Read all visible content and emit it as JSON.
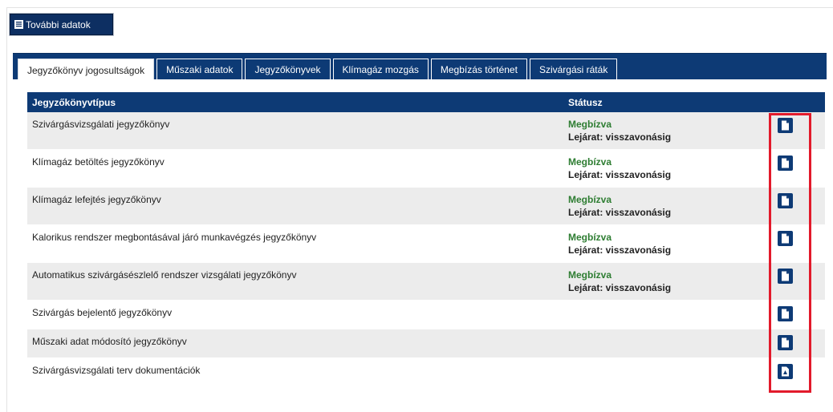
{
  "toolbar": {
    "more_data_label": "További adatok"
  },
  "tabs": [
    {
      "label": "Jegyzőkönyv jogosultságok",
      "active": true
    },
    {
      "label": "Műszaki adatok",
      "active": false
    },
    {
      "label": "Jegyzőkönyvek",
      "active": false
    },
    {
      "label": "Klímagáz mozgás",
      "active": false
    },
    {
      "label": "Megbízás történet",
      "active": false
    },
    {
      "label": "Szivárgási ráták",
      "active": false
    }
  ],
  "table": {
    "headers": {
      "type": "Jegyzőkönyvtípus",
      "status": "Státusz"
    },
    "rows": [
      {
        "type": "Szivárgásvizsgálati jegyzőkönyv",
        "status": "Megbízva",
        "expiry": "Lejárat: visszavonásig",
        "icon": "document-icon"
      },
      {
        "type": "Klímagáz betöltés jegyzőkönyv",
        "status": "Megbízva",
        "expiry": "Lejárat: visszavonásig",
        "icon": "document-icon"
      },
      {
        "type": "Klímagáz lefejtés jegyzőkönyv",
        "status": "Megbízva",
        "expiry": "Lejárat: visszavonásig",
        "icon": "document-icon"
      },
      {
        "type": "Kalorikus rendszer megbontásával járó munkavégzés jegyzőkönyv",
        "status": "Megbízva",
        "expiry": "Lejárat: visszavonásig",
        "icon": "document-icon"
      },
      {
        "type": "Automatikus szivárgásészlelő rendszer vizsgálati jegyzőkönyv",
        "status": "Megbízva",
        "expiry": "Lejárat: visszavonásig",
        "icon": "document-icon"
      },
      {
        "type": "Szivárgás bejelentő jegyzőkönyv",
        "status": "",
        "expiry": "",
        "icon": "document-icon"
      },
      {
        "type": "Műszaki adat módosító jegyzőkönyv",
        "status": "",
        "expiry": "",
        "icon": "document-icon"
      },
      {
        "type": "Szivárgásvizsgálati terv dokumentációk",
        "status": "",
        "expiry": "",
        "icon": "pdf-icon"
      }
    ]
  },
  "colors": {
    "header": "#0d3a75",
    "status_ok": "#2e7d32",
    "highlight": "#e21a2b"
  }
}
